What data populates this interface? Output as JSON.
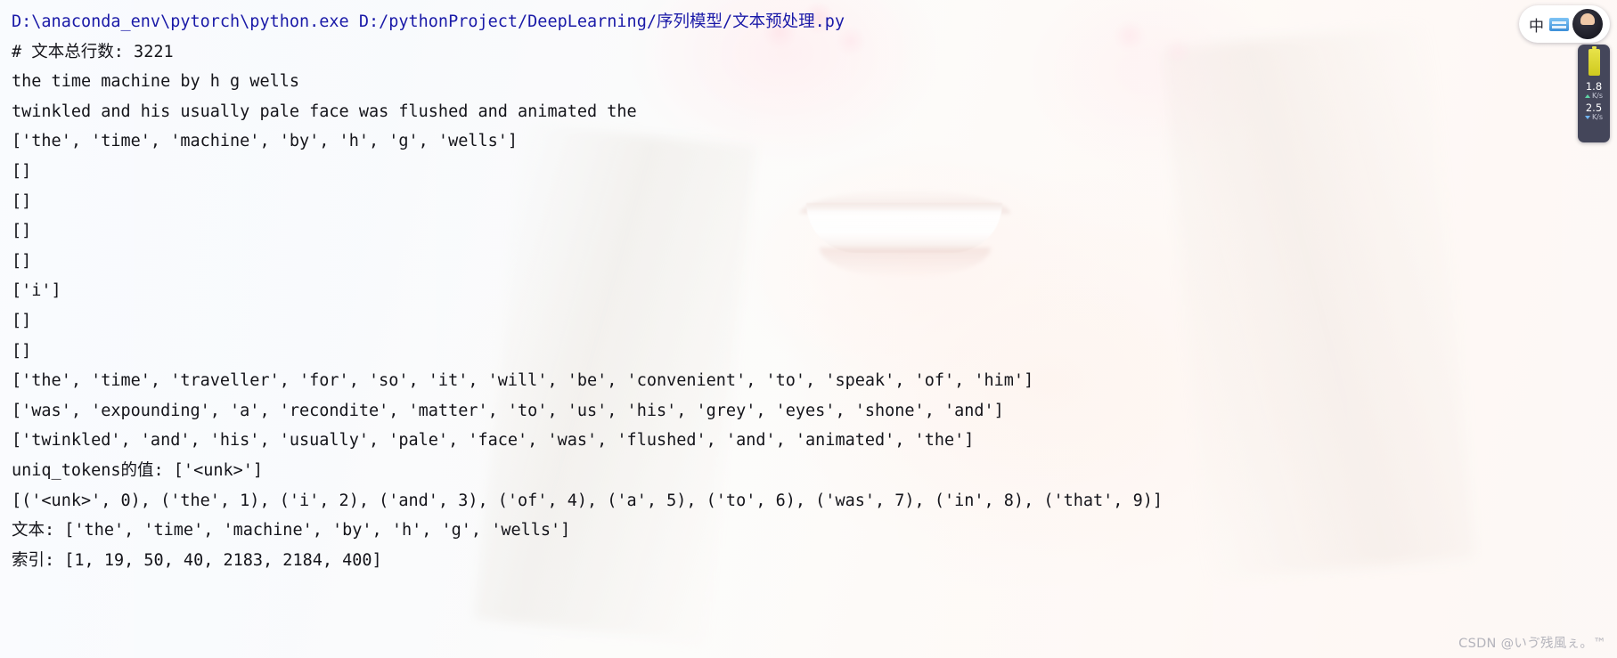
{
  "console": {
    "lines": [
      {
        "text": "D:\\anaconda_env\\pytorch\\python.exe D:/pythonProject/DeepLearning/序列模型/文本预处理.py",
        "style": "path"
      },
      {
        "text": "# 文本总行数: 3221",
        "style": "normal"
      },
      {
        "text": "the time machine by h g wells",
        "style": "normal"
      },
      {
        "text": "twinkled and his usually pale face was flushed and animated the",
        "style": "normal"
      },
      {
        "text": "['the', 'time', 'machine', 'by', 'h', 'g', 'wells']",
        "style": "normal"
      },
      {
        "text": "[]",
        "style": "normal"
      },
      {
        "text": "[]",
        "style": "normal"
      },
      {
        "text": "[]",
        "style": "normal"
      },
      {
        "text": "[]",
        "style": "normal"
      },
      {
        "text": "['i']",
        "style": "normal"
      },
      {
        "text": "[]",
        "style": "normal"
      },
      {
        "text": "[]",
        "style": "normal"
      },
      {
        "text": "['the', 'time', 'traveller', 'for', 'so', 'it', 'will', 'be', 'convenient', 'to', 'speak', 'of', 'him']",
        "style": "normal"
      },
      {
        "text": "['was', 'expounding', 'a', 'recondite', 'matter', 'to', 'us', 'his', 'grey', 'eyes', 'shone', 'and']",
        "style": "normal"
      },
      {
        "text": "['twinkled', 'and', 'his', 'usually', 'pale', 'face', 'was', 'flushed', 'and', 'animated', 'the']",
        "style": "normal"
      },
      {
        "text": "uniq_tokens的值: ['<unk>']",
        "style": "normal"
      },
      {
        "text": "[('<unk>', 0), ('the', 1), ('i', 2), ('and', 3), ('of', 4), ('a', 5), ('to', 6), ('was', 7), ('in', 8), ('that', 9)]",
        "style": "normal"
      },
      {
        "text": "文本: ['the', 'time', 'machine', 'by', 'h', 'g', 'wells']",
        "style": "normal"
      },
      {
        "text": "索引: [1, 19, 50, 40, 2183, 2184, 400]",
        "style": "normal"
      }
    ]
  },
  "ime_widget": {
    "mode_label": "中",
    "keyboard_icon": "keyboard-icon",
    "avatar_icon": "user-avatar-icon"
  },
  "net_widget": {
    "battery_icon": "battery-icon",
    "upload_value": "1.8",
    "upload_unit": "K/s",
    "download_value": "2.5",
    "download_unit": "K/s"
  },
  "watermark": {
    "text": "CSDN @いゔ残風ぇ。™"
  },
  "colors": {
    "path_text": "#1a1aa8",
    "body_text": "#14141a",
    "watermark_text": "#b4b4bc",
    "net_widget_bg": "#44465a"
  }
}
